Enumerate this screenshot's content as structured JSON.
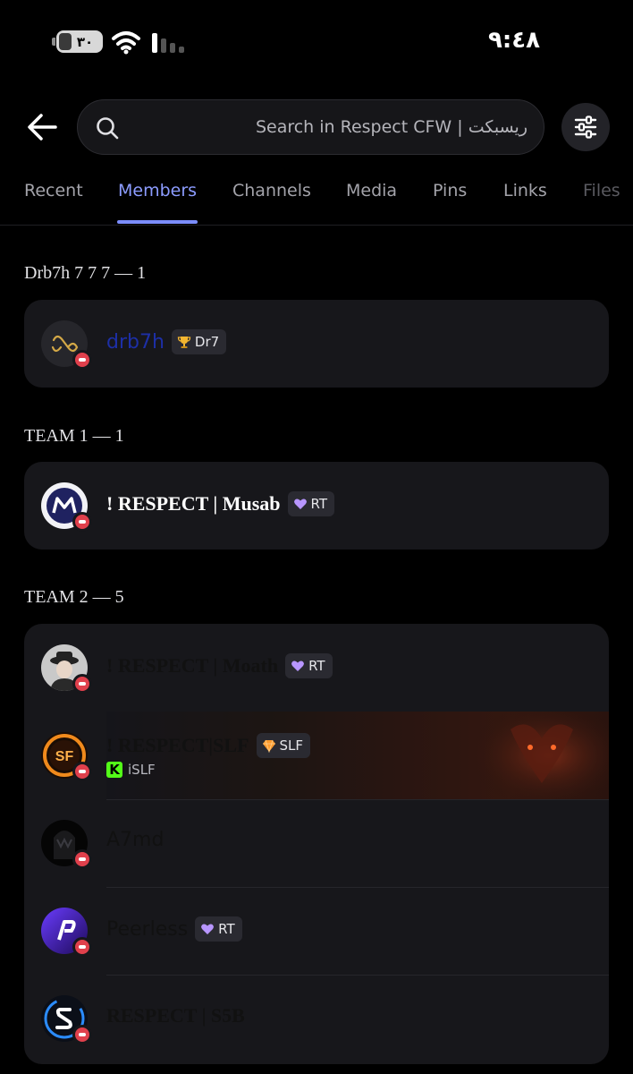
{
  "status_bar": {
    "battery": "٣٠",
    "time": "٩:٤٨"
  },
  "search": {
    "placeholder": "Search in Respect CFW | ريسبكت"
  },
  "tabs": [
    {
      "label": "Recent"
    },
    {
      "label": "Members"
    },
    {
      "label": "Channels"
    },
    {
      "label": "Media"
    },
    {
      "label": "Pins"
    },
    {
      "label": "Links"
    },
    {
      "label": "Files"
    }
  ],
  "active_tab": "Members",
  "sections": [
    {
      "title": "Drb7h 7 7 7 — 1",
      "members": [
        {
          "name": "drb7h",
          "tag": "Dr7",
          "tag_icon": "trophy-icon",
          "name_color": "#1d2fa6",
          "status": "do-not-disturb"
        }
      ]
    },
    {
      "title": "TEAM 1 — 1",
      "members": [
        {
          "name": "! RESPECT | Musab",
          "tag": "RT",
          "tag_icon": "purple-heart-icon",
          "name_color": "#ffffff",
          "status": "do-not-disturb"
        }
      ]
    },
    {
      "title": "TEAM 2 — 5",
      "members": [
        {
          "name": "!        RESPECT | Moath",
          "tag": "RT",
          "tag_icon": "purple-heart-icon",
          "name_color": "#111111",
          "status": "do-not-disturb"
        },
        {
          "name": "! RESPECT|SLF",
          "tag": "SLF",
          "tag_icon": "orange-gem-icon",
          "activity": "iSLF",
          "activity_icon": "kick-icon",
          "name_color": "#111111",
          "status": "do-not-disturb"
        },
        {
          "name": "A7md",
          "name_color": "#111111",
          "status": "do-not-disturb"
        },
        {
          "name": "Peerless",
          "tag": "RT",
          "tag_icon": "purple-heart-icon",
          "name_color": "#111111",
          "status": "do-not-disturb"
        },
        {
          "name": "RESPECT | S5B",
          "name_color": "#111111",
          "status": "do-not-disturb"
        }
      ]
    }
  ]
}
